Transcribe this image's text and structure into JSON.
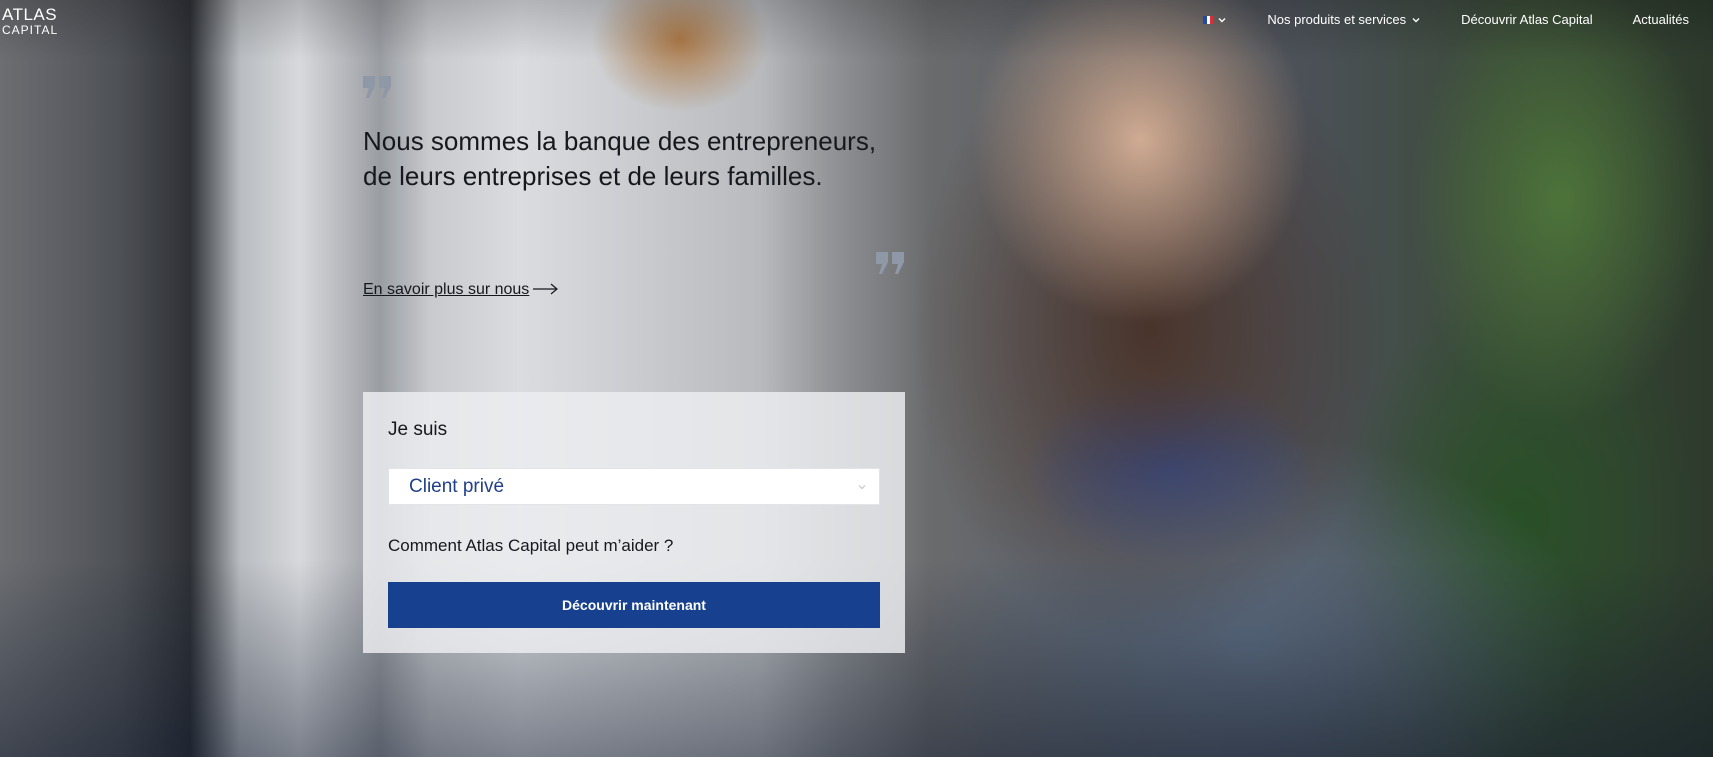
{
  "header": {
    "logo_line1": "ATLAS",
    "logo_line2": "CAPITAL",
    "language": {
      "icon": "france-flag-icon",
      "flag_colors": [
        "#1f4aa8",
        "#ffffff",
        "#d6303a"
      ]
    },
    "nav": [
      {
        "label": "Nos produits et services",
        "has_dropdown": true
      },
      {
        "label": "Découvrir Atlas Capital",
        "has_dropdown": false
      },
      {
        "label": "Actualités",
        "has_dropdown": false
      }
    ]
  },
  "hero": {
    "headline": "Nous sommes la banque des entrepreneurs, de leurs entreprises et de leurs familles.",
    "learn_more": "En savoir plus sur nous",
    "quote_icon": "quote-mark-icon",
    "quote_color": "#8e98a6"
  },
  "selector": {
    "title": "Je suis",
    "selected": "Client privé",
    "question": "Comment Atlas Capital peut m’aider ?",
    "button": "Découvrir maintenant"
  },
  "colors": {
    "accent": "#17418f",
    "select_text": "#22408a",
    "text_dark": "#15181d"
  }
}
